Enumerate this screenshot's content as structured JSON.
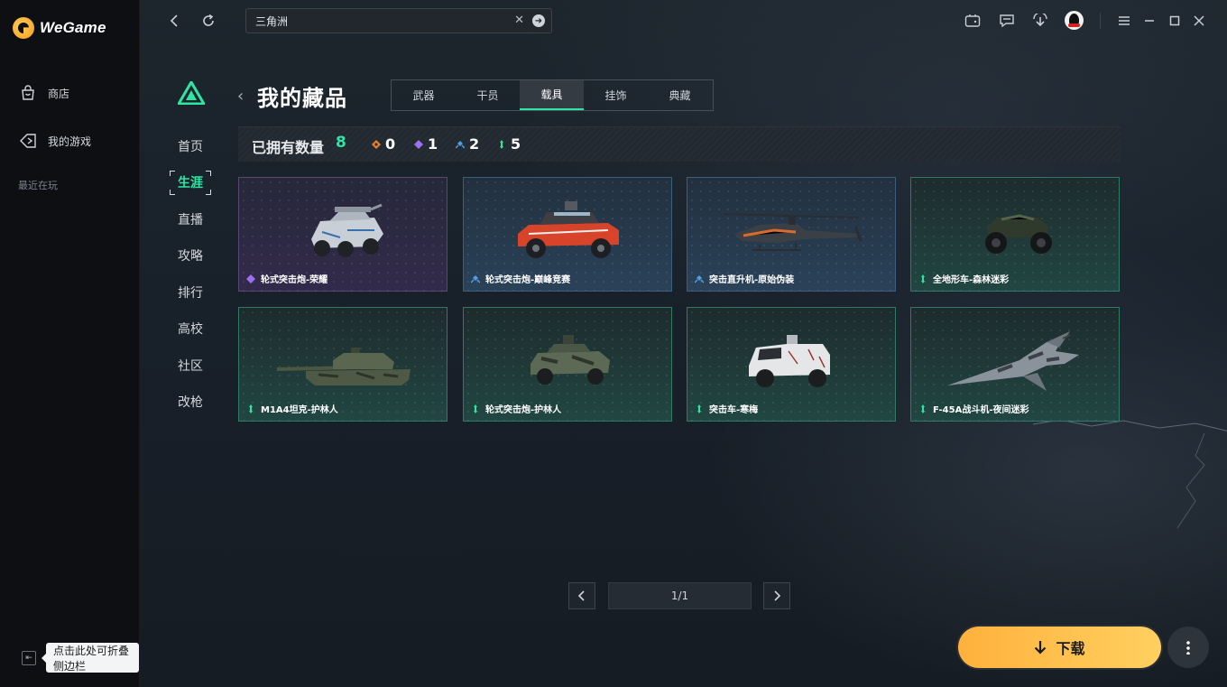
{
  "app": {
    "brand": "WeGame"
  },
  "sidebar": {
    "items": [
      {
        "label": "商店",
        "icon": "shop-bag-icon"
      },
      {
        "label": "我的游戏",
        "icon": "game-controller-icon"
      }
    ],
    "recent_label": "最近在玩",
    "collapse_tooltip": "点击此处可折叠侧边栏"
  },
  "topbar": {
    "search": {
      "value": "三角洲",
      "placeholder": ""
    }
  },
  "game_nav": {
    "items": [
      "首页",
      "生涯",
      "直播",
      "攻略",
      "排行",
      "高校",
      "社区",
      "改枪"
    ],
    "active": "生涯"
  },
  "collection": {
    "title": "我的藏品",
    "tabs": [
      "武器",
      "干员",
      "载具",
      "挂饰",
      "典藏"
    ],
    "active_tab": "载具",
    "owned_label": "已拥有数量",
    "owned_total": "8",
    "rarity_counts": [
      {
        "icon": "orange-rarity-icon",
        "count": "0",
        "color": "#e8822e"
      },
      {
        "icon": "purple-rarity-icon",
        "count": "1",
        "color": "#9d6ff0"
      },
      {
        "icon": "blue-rarity-icon",
        "count": "2",
        "color": "#4f9ee6"
      },
      {
        "icon": "green-rarity-icon",
        "count": "5",
        "color": "#2ee6a4"
      }
    ],
    "items": [
      {
        "name": "轮式突击炮-荣耀",
        "rarity": "purple",
        "vehicle": "wheeled-assault-gun-icon"
      },
      {
        "name": "轮式突击炮-巅峰竞赛",
        "rarity": "blue",
        "vehicle": "red-assault-buggy-icon"
      },
      {
        "name": "突击直升机-原始伪装",
        "rarity": "blue",
        "vehicle": "attack-helicopter-icon"
      },
      {
        "name": "全地形车-森林迷彩",
        "rarity": "green",
        "vehicle": "atv-icon"
      },
      {
        "name": "M1A4坦克-护林人",
        "rarity": "green",
        "vehicle": "tank-icon"
      },
      {
        "name": "轮式突击炮-护林人",
        "rarity": "green",
        "vehicle": "camo-assault-gun-icon"
      },
      {
        "name": "突击车-寒梅",
        "rarity": "green",
        "vehicle": "armored-truck-icon"
      },
      {
        "name": "F-45A战斗机-夜间迷彩",
        "rarity": "green",
        "vehicle": "fighter-jet-icon"
      }
    ],
    "pagination": {
      "current": "1/1"
    }
  },
  "actions": {
    "download_label": "下载"
  },
  "colors": {
    "accent": "#2ee6a4",
    "download": "#ffb13c"
  }
}
